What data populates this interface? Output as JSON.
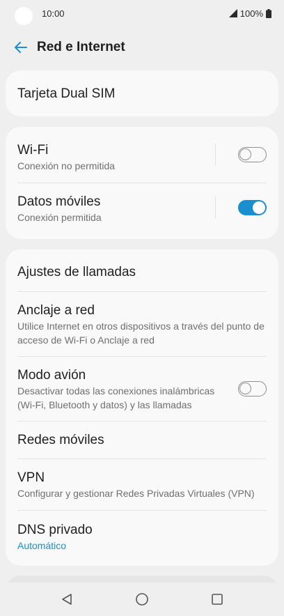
{
  "status_bar": {
    "time": "10:00",
    "battery_text": "100%",
    "icons": [
      "signal-icon",
      "battery-icon"
    ]
  },
  "header": {
    "title": "Red e Internet",
    "back_icon": "arrow-left-icon"
  },
  "colors": {
    "accent": "#1a8fd0",
    "background": "#efefef",
    "card": "#f9f9f9"
  },
  "cards": {
    "dual_sim": {
      "title": "Tarjeta Dual SIM"
    },
    "connections": {
      "wifi": {
        "title": "Wi-Fi",
        "subtitle": "Conexión no permitida",
        "enabled": false
      },
      "mobile_data": {
        "title": "Datos móviles",
        "subtitle": "Conexión permitida",
        "enabled": true
      }
    },
    "settings": {
      "call_settings": {
        "title": "Ajustes de llamadas"
      },
      "tethering": {
        "title": "Anclaje a red",
        "subtitle": "Utilice Internet en otros dispositivos a través del punto de acceso de Wi-Fi o Anclaje a red"
      },
      "airplane": {
        "title": "Modo avión",
        "subtitle": "Desactivar todas las conexiones inalámbricas (Wi-Fi, Bluetooth y datos) y las llamadas",
        "enabled": false
      },
      "mobile_networks": {
        "title": "Redes móviles"
      },
      "vpn": {
        "title": "VPN",
        "subtitle": "Configurar y gestionar Redes Privadas Virtuales (VPN)"
      },
      "private_dns": {
        "title": "DNS privado",
        "subtitle": "Automático"
      }
    }
  },
  "nav_bar": {
    "icons": [
      "back-triangle-icon",
      "home-circle-icon",
      "recents-square-icon"
    ]
  }
}
